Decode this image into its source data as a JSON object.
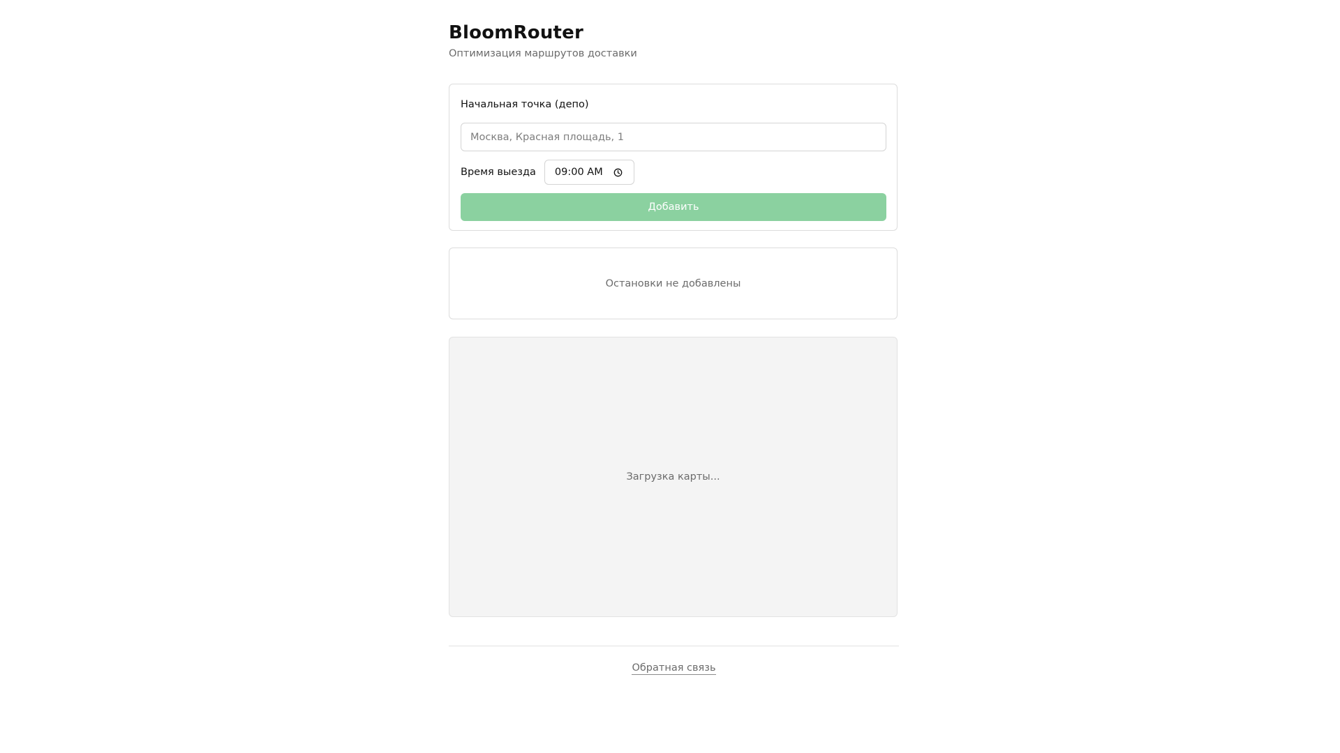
{
  "header": {
    "title": "BloomRouter",
    "subtitle": "Оптимизация маршрутов доставки"
  },
  "form": {
    "depot_label": "Начальная точка (депо)",
    "depot_value": "",
    "depot_placeholder": "Москва, Красная площадь, 1",
    "departure_label": "Время выезда",
    "departure_time": "09:00 AM",
    "add_button_label": "Добавить",
    "add_button_color": "#8bd1a0",
    "time_icon": "clock-icon"
  },
  "stops": {
    "empty_text": "Остановки не добавлены",
    "items": []
  },
  "map": {
    "loading_text": "Загрузка карты..."
  },
  "footer": {
    "feedback_label": "Обратная связь"
  }
}
